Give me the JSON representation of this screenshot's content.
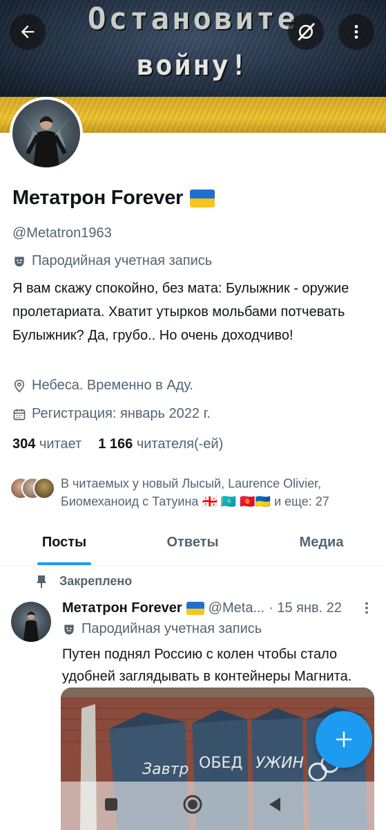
{
  "banner": {
    "line1": "Остановите",
    "line2": "войну!"
  },
  "profile": {
    "display_name": "Метатрон Forever",
    "handle": "@Metatron1963",
    "parody_label": "Пародийная учетная запись",
    "bio": "Я вам скажу спокойно, без мата: Булыжник - оружие пролетариата. Хватит утырков мольбами потчевать Булыжник? Да, грубо.. Но очень доходчиво!",
    "location": "Небеса. Временно в Аду.",
    "joined": "Регистрация: январь 2022 г.",
    "following_count": "304",
    "following_label": "читает",
    "followers_count": "1 166",
    "followers_label": "читателя(-ей)",
    "followed_by_text": "В читаемых у новый Лысый, Laurence Olivier, Биомеханоид с Татуина 🇬🇪 🇰🇿 🇰🇬🇺🇦 и еще: 27"
  },
  "tabs": [
    {
      "label": "Посты",
      "active": true
    },
    {
      "label": "Ответы",
      "active": false
    },
    {
      "label": "Медиа",
      "active": false
    }
  ],
  "pinned_post": {
    "pinned_label": "Закреплено",
    "author_name": "Метатрон Forever",
    "author_handle": "@Meta...",
    "date": "· 15 янв. 22",
    "parody_label": "Пародийная учетная запись",
    "text": "Путен поднял Россию с колен чтобы стало удобней заглядывать в контейнеры Магнита.",
    "image_graffiti": [
      "Завтр",
      "ОБЕД",
      "УЖИН"
    ]
  },
  "colors": {
    "accent": "#1d9bf0",
    "text_primary": "#0f1419",
    "text_secondary": "#536471",
    "flag_blue": "#1f6fd1",
    "flag_yellow": "#f6c61d"
  },
  "icons": {
    "back": "arrow-left-icon",
    "grok": "grok-icon",
    "more": "more-vertical-icon",
    "parody": "theater-mask-icon",
    "location": "location-pin-icon",
    "calendar": "calendar-icon",
    "pin": "pin-icon",
    "compose": "plus-icon",
    "nav_recents": "square-icon",
    "nav_home": "circle-icon",
    "nav_back": "triangle-back-icon"
  }
}
